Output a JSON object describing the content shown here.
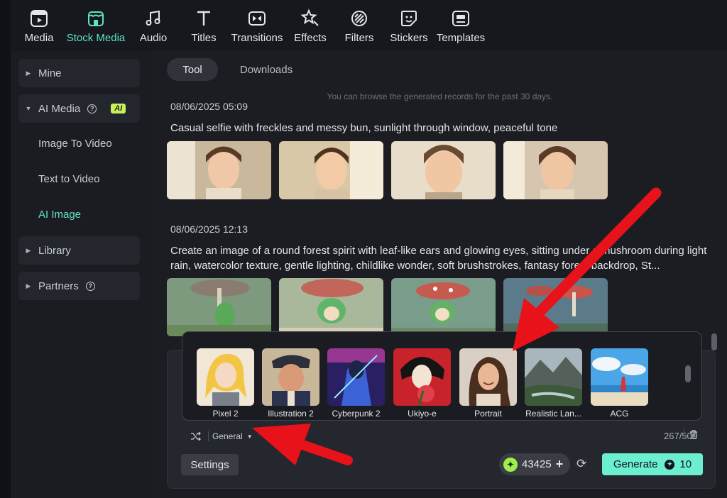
{
  "toolbar": {
    "items": [
      {
        "label": "Media",
        "icon": "media-icon"
      },
      {
        "label": "Stock Media",
        "icon": "stock-media-icon",
        "active": true
      },
      {
        "label": "Audio",
        "icon": "music-note-icon"
      },
      {
        "label": "Titles",
        "icon": "text-t-icon"
      },
      {
        "label": "Transitions",
        "icon": "transitions-icon"
      },
      {
        "label": "Effects",
        "icon": "effects-icon"
      },
      {
        "label": "Filters",
        "icon": "filters-icon"
      },
      {
        "label": "Stickers",
        "icon": "stickers-icon"
      },
      {
        "label": "Templates",
        "icon": "templates-icon"
      }
    ]
  },
  "sidebar": {
    "mine": "Mine",
    "ai_media": "AI Media",
    "ai_badge": "AI",
    "image_to_video": "Image To Video",
    "text_to_video": "Text to Video",
    "ai_image": "AI Image",
    "library": "Library",
    "partners": "Partners"
  },
  "tabs": {
    "tool": "Tool",
    "downloads": "Downloads"
  },
  "hint": "You can browse the generated records for the past 30 days.",
  "records": [
    {
      "date": "08/06/2025 05:09",
      "prompt": "Casual selfie with freckles and messy bun, sunlight through window, peaceful tone"
    },
    {
      "date": "08/06/2025 12:13",
      "prompt": "Create an image of a round forest spirit with leaf-like ears and glowing eyes, sitting under a mushroom during light rain, watercolor texture, gentle lighting, childlike wonder, soft brushstrokes, fantasy forest backdrop, St..."
    }
  ],
  "styles": [
    {
      "name": "Pixel 2"
    },
    {
      "name": "Illustration 2"
    },
    {
      "name": "Cyberpunk 2"
    },
    {
      "name": "Ukiyo-e"
    },
    {
      "name": "Portrait"
    },
    {
      "name": "Realistic Lan..."
    },
    {
      "name": "ACG"
    }
  ],
  "compose": {
    "shuffle_icon": "shuffle-icon",
    "style_select": "General",
    "char_count": "267/500",
    "settings": "Settings",
    "credits": "43425",
    "generate": "Generate",
    "generate_cost": "10"
  },
  "colors": {
    "accent": "#5ee2c5",
    "generate_button": "#6cefd1",
    "annotation_arrow": "#e8121b",
    "ai_badge": "#c8f25a"
  }
}
